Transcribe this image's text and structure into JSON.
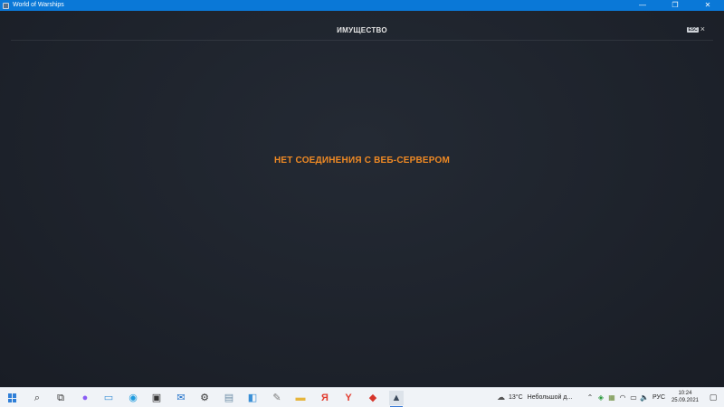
{
  "window": {
    "title": "World of Warships",
    "controls": {
      "minimize": "—",
      "maximize": "❐",
      "close": "✕"
    }
  },
  "game": {
    "header_title": "ИМУЩЕСТВО",
    "esc_label": "ESC",
    "close_symbol": "×",
    "error_message": "НЕТ СОЕДИНЕНИЯ С ВЕБ-СЕРВЕРОМ"
  },
  "taskbar": {
    "items": [
      {
        "name": "start",
        "icon": "windows-logo-icon"
      },
      {
        "name": "search",
        "icon": "search-icon",
        "glyph": "⌕",
        "color": "#333333"
      },
      {
        "name": "task-view",
        "icon": "task-view-icon",
        "glyph": "⧉",
        "color": "#333333"
      },
      {
        "name": "alice",
        "icon": "alice-assistant-icon",
        "glyph": "●",
        "color": "#8a5cf5"
      },
      {
        "name": "remote-desktop",
        "icon": "monitor-icon",
        "glyph": "▭",
        "color": "#3a8fd6"
      },
      {
        "name": "edge",
        "icon": "edge-browser-icon",
        "glyph": "◉",
        "color": "#1f9bde"
      },
      {
        "name": "store",
        "icon": "store-bag-icon",
        "glyph": "▣",
        "color": "#333333"
      },
      {
        "name": "mail",
        "icon": "mail-icon",
        "glyph": "✉",
        "color": "#1e6fc9"
      },
      {
        "name": "settings",
        "icon": "gear-icon",
        "glyph": "⚙",
        "color": "#333333"
      },
      {
        "name": "photos",
        "icon": "photo-viewer-icon",
        "glyph": "▤",
        "color": "#6f8fa8"
      },
      {
        "name": "control-panel",
        "icon": "control-panel-icon",
        "glyph": "◧",
        "color": "#3a8fd6"
      },
      {
        "name": "paint",
        "icon": "paint-brush-icon",
        "glyph": "✎",
        "color": "#7a7a7a"
      },
      {
        "name": "explorer",
        "icon": "folder-icon",
        "glyph": "▬",
        "color": "#e6b53c"
      },
      {
        "name": "yandex",
        "icon": "yandex-icon",
        "glyph": "Я",
        "color": "#e23b2e"
      },
      {
        "name": "yandex-browser",
        "icon": "yandex-browser-icon",
        "glyph": "Y",
        "color": "#e23b2e"
      },
      {
        "name": "wargaming-center",
        "icon": "wargaming-center-icon",
        "glyph": "◆",
        "color": "#d6352b"
      },
      {
        "name": "world-of-warships",
        "icon": "world-of-warships-icon",
        "glyph": "▲",
        "color": "#3c4a5c",
        "active": true
      }
    ],
    "weather": {
      "icon": "cloud-icon",
      "temperature": "13°C",
      "description": "Небольшой д..."
    },
    "tray_icons": [
      {
        "name": "chevron-up-icon",
        "glyph": "⌃",
        "color": "#333333"
      },
      {
        "name": "shield-icon",
        "glyph": "◈",
        "color": "#2a9a3c"
      },
      {
        "name": "app-tray-icon",
        "glyph": "▦",
        "color": "#6b8c3a"
      },
      {
        "name": "wifi-icon",
        "glyph": "◠",
        "color": "#333333"
      },
      {
        "name": "battery-icon",
        "glyph": "▭",
        "color": "#333333"
      },
      {
        "name": "volume-icon",
        "glyph": "🔈",
        "color": "#333333"
      }
    ],
    "language": "РУС",
    "time": "10:24",
    "date": "25.09.2021",
    "notification_glyph": "▢"
  }
}
